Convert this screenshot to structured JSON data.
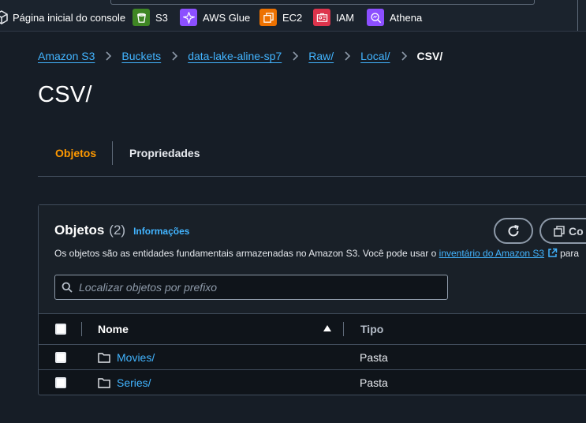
{
  "favorites": {
    "items": [
      {
        "label": "Página inicial do console",
        "icon": "cube-icon"
      },
      {
        "label": "S3",
        "icon": "s3-bucket-icon",
        "color": "#3f8624"
      },
      {
        "label": "AWS Glue",
        "icon": "glue-icon",
        "color": "#8c4fff"
      },
      {
        "label": "EC2",
        "icon": "ec2-icon",
        "color": "#ed7100"
      },
      {
        "label": "IAM",
        "icon": "iam-icon",
        "color": "#dd344c"
      },
      {
        "label": "Athena",
        "icon": "athena-icon",
        "color": "#8c4fff"
      }
    ]
  },
  "breadcrumb": {
    "items": [
      "Amazon S3",
      "Buckets",
      "data-lake-aline-sp7",
      "Raw/",
      "Local/"
    ],
    "current": "CSV/"
  },
  "page": {
    "title": "CSV/"
  },
  "tabs": {
    "items": [
      "Objetos",
      "Propriedades"
    ],
    "active": "Objetos",
    "active_color": "#ff9900"
  },
  "objects_panel": {
    "title": "Objetos",
    "count": "(2)",
    "info_link": "Informações",
    "description_prefix": "Os objetos são as entidades fundamentais armazenadas no Amazon S3. Você pode usar o",
    "description_link": "inventário do Amazon S3",
    "description_suffix": "para",
    "copy_button_label": "Co",
    "search": {
      "placeholder": "Localizar objetos por prefixo",
      "value": ""
    }
  },
  "table": {
    "columns": [
      "Nome",
      "Tipo"
    ],
    "sort": "ascending",
    "rows": [
      {
        "name": "Movies/",
        "type": "Pasta"
      },
      {
        "name": "Series/",
        "type": "Pasta"
      }
    ]
  },
  "colors": {
    "background": "#161d26",
    "link": "#42b4ff",
    "accent": "#ff9900"
  }
}
